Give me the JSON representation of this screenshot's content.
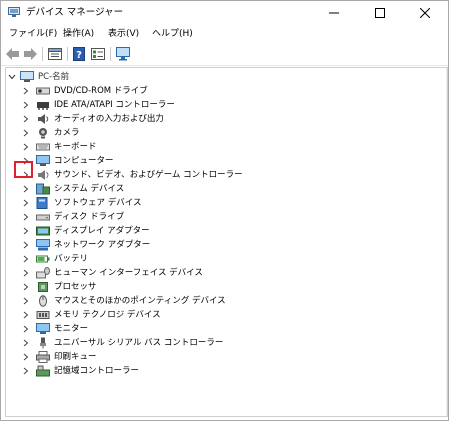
{
  "window": {
    "title": "デバイス マネージャー"
  },
  "menu": [
    {
      "label": "ファイル(F)"
    },
    {
      "label": "操作(A)"
    },
    {
      "label": "表示(V)"
    },
    {
      "label": "ヘルプ(H)"
    }
  ],
  "toolbar_icons": [
    "back-icon",
    "forward-icon",
    "properties-icon",
    "help-icon",
    "view-icon",
    "monitor-scan-icon"
  ],
  "tree": {
    "root_label": "PC-名前",
    "items": [
      {
        "label": "DVD/CD-ROM ドライブ",
        "icon": "dvd-drive-icon"
      },
      {
        "label": "IDE ATA/ATAPI コントローラー",
        "icon": "ide-controller-icon"
      },
      {
        "label": "オーディオの入力および出力",
        "icon": "audio-icon"
      },
      {
        "label": "カメラ",
        "icon": "camera-icon"
      },
      {
        "label": "キーボード",
        "icon": "keyboard-icon"
      },
      {
        "label": "コンピューター",
        "icon": "computer-icon"
      },
      {
        "label": "サウンド、ビデオ、およびゲーム コントローラー",
        "icon": "sound-icon"
      },
      {
        "label": "システム デバイス",
        "icon": "system-device-icon"
      },
      {
        "label": "ソフトウェア デバイス",
        "icon": "software-device-icon"
      },
      {
        "label": "ディスク ドライブ",
        "icon": "disk-drive-icon"
      },
      {
        "label": "ディスプレイ アダプター",
        "icon": "display-adapter-icon"
      },
      {
        "label": "ネットワーク アダプター",
        "icon": "network-adapter-icon"
      },
      {
        "label": "バッテリ",
        "icon": "battery-icon"
      },
      {
        "label": "ヒューマン インターフェイス デバイス",
        "icon": "hid-icon"
      },
      {
        "label": "プロセッサ",
        "icon": "processor-icon"
      },
      {
        "label": "マウスとそのほかのポインティング デバイス",
        "icon": "mouse-icon"
      },
      {
        "label": "メモリ テクノロジ デバイス",
        "icon": "memory-icon"
      },
      {
        "label": "モニター",
        "icon": "monitor-icon"
      },
      {
        "label": "ユニバーサル シリアル バス コントローラー",
        "icon": "usb-icon"
      },
      {
        "label": "印刷キュー",
        "icon": "print-queue-icon"
      },
      {
        "label": "記憶域コントローラー",
        "icon": "storage-controller-icon"
      }
    ]
  },
  "colors": {
    "highlight": "#e0202a",
    "accent": "#2a6ebb"
  }
}
